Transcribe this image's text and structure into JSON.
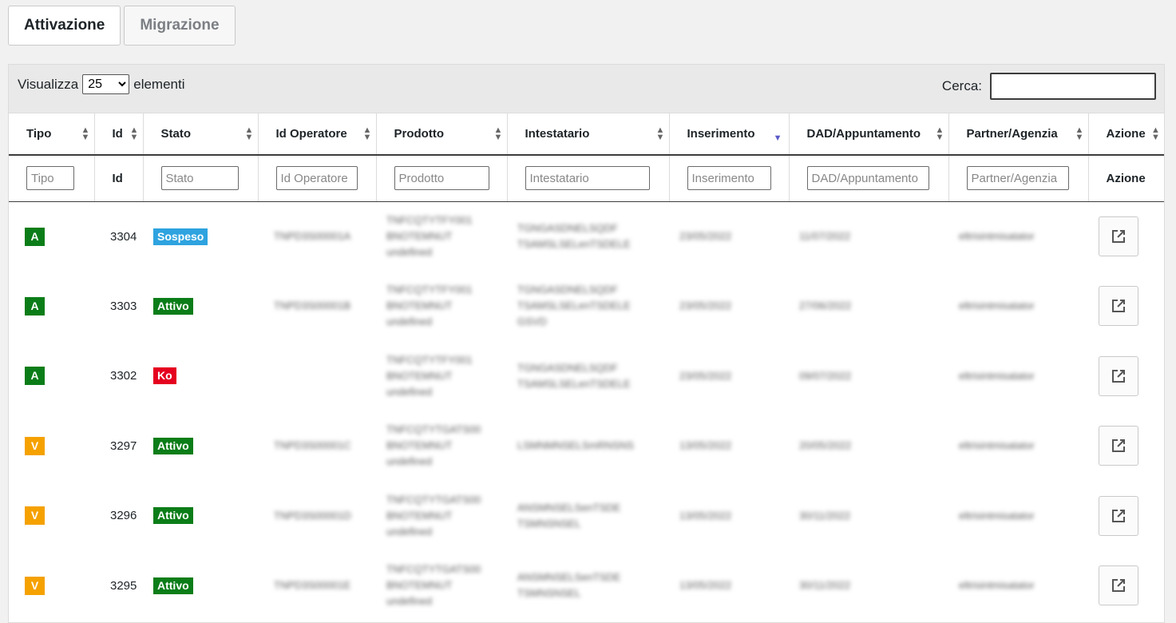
{
  "tabs": [
    {
      "label": "Attivazione",
      "active": true
    },
    {
      "label": "Migrazione",
      "active": false
    }
  ],
  "toolbar": {
    "show_label": "Visualizza",
    "show_value": "25",
    "elements_label": "elementi",
    "search_label": "Cerca:"
  },
  "columns": [
    {
      "label": "Tipo",
      "filter_placeholder": "Tipo"
    },
    {
      "label": "Id",
      "filter_placeholder": "Id"
    },
    {
      "label": "Stato",
      "filter_placeholder": "Stato"
    },
    {
      "label": "Id Operatore",
      "filter_placeholder": "Id Operatore"
    },
    {
      "label": "Prodotto",
      "filter_placeholder": "Prodotto"
    },
    {
      "label": "Intestatario",
      "filter_placeholder": "Intestatario"
    },
    {
      "label": "Inserimento",
      "filter_placeholder": "Inserimento"
    },
    {
      "label": "DAD/Appuntamento",
      "filter_placeholder": "DAD/Appuntamento"
    },
    {
      "label": "Partner/Agenzia",
      "filter_placeholder": "Partner/Agenzia"
    },
    {
      "label": "Azione",
      "filter_placeholder": "Azione"
    }
  ],
  "colors": {
    "type_a": "#0b7d18",
    "type_v": "#f5a100",
    "status_sospeso": "#2ea3df",
    "status_attivo": "#0b7d18",
    "status_ko": "#e5001f"
  },
  "icons": {
    "sort": "sort-icon",
    "sort_desc": "sort-desc-icon",
    "action": "external-link-icon"
  },
  "rows": [
    {
      "tipo": "A",
      "id": "3304",
      "stato": "Sospeso"
    },
    {
      "tipo": "A",
      "id": "3303",
      "stato": "Attivo"
    },
    {
      "tipo": "A",
      "id": "3302",
      "stato": "Ko"
    },
    {
      "tipo": "V",
      "id": "3297",
      "stato": "Attivo"
    },
    {
      "tipo": "V",
      "id": "3296",
      "stato": "Attivo"
    },
    {
      "tipo": "V",
      "id": "3295",
      "stato": "Attivo"
    }
  ]
}
